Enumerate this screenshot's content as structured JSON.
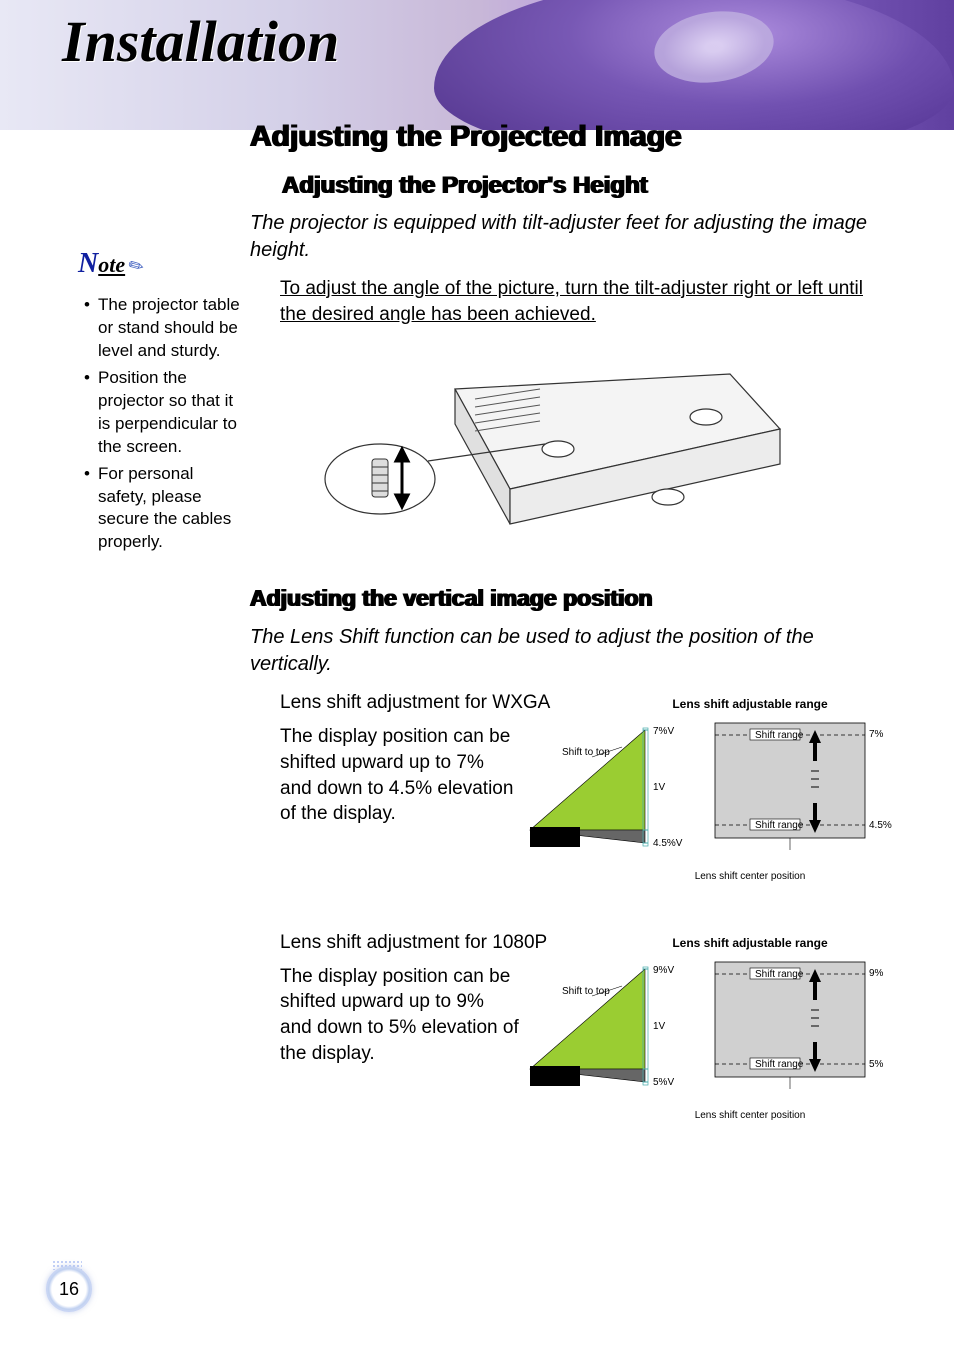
{
  "header": {
    "title": "Installation"
  },
  "page_number": "16",
  "sidebar": {
    "note_label_n": "N",
    "note_label_ote": "ote",
    "items": [
      "The projector table or stand should be level and sturdy.",
      "Position the projector so that it is perpendicular to the screen.",
      "For personal safety, please secure the cables properly."
    ]
  },
  "main": {
    "h1": "Adjusting the Projected Image",
    "sec1": {
      "h2": "Adjusting the Projector's Height",
      "intro": "The projector is equipped with tilt-adjuster feet for adjusting the image height.",
      "instruction": "To adjust the angle of the picture, turn the tilt-adjuster right or left until the desired angle has been achieved."
    },
    "sec2": {
      "h2": "Adjusting the vertical image position",
      "intro": "The Lens Shift function can be used to adjust the position of the vertically.",
      "wxga": {
        "sub": "Lens shift adjustment for WXGA",
        "para": "The display position can be shifted upward up to 7% and down to 4.5% elevation of the display.",
        "chart_title": "Lens shift adjustable range",
        "caption": "Lens shift center position"
      },
      "p1080": {
        "sub": "Lens shift adjustment for 1080P",
        "para": "The display position can be shifted upward up to 9% and down to 5% elevation of the display.",
        "chart_title": "Lens shift adjustable range",
        "caption": "Lens shift center position"
      }
    }
  },
  "labels": {
    "shift_to_top": "Shift to top",
    "shift_range": "Shift range",
    "one_v": "1V"
  },
  "chart_data": [
    {
      "type": "diagram",
      "name": "lens-shift-wxga",
      "upper_percent": 7,
      "lower_percent": 4.5,
      "upper_label": "7%V",
      "lower_label": "4.5%V",
      "upper_right": "7%",
      "lower_right": "4.5%",
      "center": "1V"
    },
    {
      "type": "diagram",
      "name": "lens-shift-1080p",
      "upper_percent": 9,
      "lower_percent": 5,
      "upper_label": "9%V",
      "lower_label": "5%V",
      "upper_right": "9%",
      "lower_right": "5%",
      "center": "1V"
    }
  ]
}
